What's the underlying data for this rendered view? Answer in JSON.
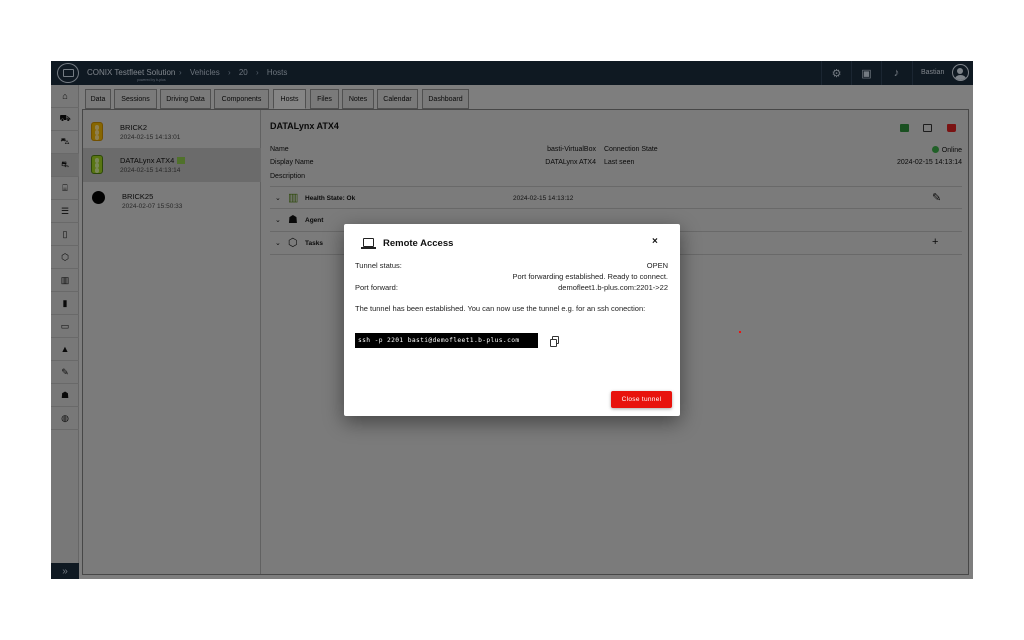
{
  "app": {
    "brand": "CONIX Testfleet Solution",
    "brand_sub": "powered by b-plus",
    "breadcrumbs": [
      "Vehicles",
      "20",
      "Hosts"
    ],
    "user_name": "Bastian",
    "icons": [
      "settings-icon",
      "calendar-icon",
      "bell-icon",
      "user-avatar-icon"
    ]
  },
  "sidebar": {
    "items": [
      "home-icon",
      "car-wash-icon",
      "fleet-icon",
      "car-icon",
      "garage-icon",
      "list-icon",
      "battery-icon",
      "box-icon",
      "trash-icon",
      "sensor-icon",
      "vehicle-icon",
      "building-icon",
      "tool-icon",
      "group-icon",
      "chat-icon"
    ],
    "expand_icon": "chevron-double-right-icon"
  },
  "tabs": [
    {
      "label": "Data",
      "active": false
    },
    {
      "label": "Sessions",
      "active": false
    },
    {
      "label": "Driving Data",
      "active": false
    },
    {
      "label": "Components",
      "active": false
    },
    {
      "label": "Hosts",
      "active": true
    },
    {
      "label": "Files",
      "active": false
    },
    {
      "label": "Notes",
      "active": false
    },
    {
      "label": "Calendar",
      "active": false
    },
    {
      "label": "Dashboard",
      "active": false
    }
  ],
  "hosts": [
    {
      "name": "BRICK2",
      "time": "2024-02-15 14:13:01",
      "status": "yellow"
    },
    {
      "name": "DATALynx ATX4",
      "time": "2024-02-15 14:13:14",
      "status": "green",
      "selected": true
    },
    {
      "name": "BRICK25",
      "time": "2024-02-07 15:50:33",
      "status": "black"
    }
  ],
  "detail": {
    "title": "DATALynx ATX4",
    "labels": {
      "name": "Name",
      "display_name": "Display Name",
      "description": "Description",
      "connection_state": "Connection State",
      "last_seen": "Last seen"
    },
    "values": {
      "name": "basti-VirtualBox",
      "display_name": "DATALynx ATX4",
      "connection_state": "Online",
      "last_seen": "2024-02-15 14:13:14"
    },
    "sections": [
      {
        "label": "Health State: Ok",
        "time": "2024-02-15 14:13:12",
        "icon": "traffic-light-icon",
        "action": "edit-icon"
      },
      {
        "label": "Agent",
        "icon": "agent-icon"
      },
      {
        "label": "Tasks",
        "icon": "cube-icon",
        "action": "plus-icon"
      }
    ],
    "colors": {
      "online": "#3aa645",
      "terminal": "#2e8b3a",
      "delete": "#d32020"
    }
  },
  "dialog": {
    "title": "Remote Access",
    "close_symbol": "×",
    "tunnel_status_label": "Tunnel status:",
    "tunnel_status_value": "OPEN",
    "status_message": "Port forwarding established. Ready to connect.",
    "port_forward_label": "Port forward:",
    "port_forward_value": "demofleet1.b-plus.com:2201->22",
    "note": "The tunnel has been established. You can now use the tunnel e.g. for an ssh conection:",
    "command": "ssh -p 2201 basti@demofleet1.b-plus.com",
    "close_button": "Close tunnel",
    "accent": "#e8130d"
  }
}
